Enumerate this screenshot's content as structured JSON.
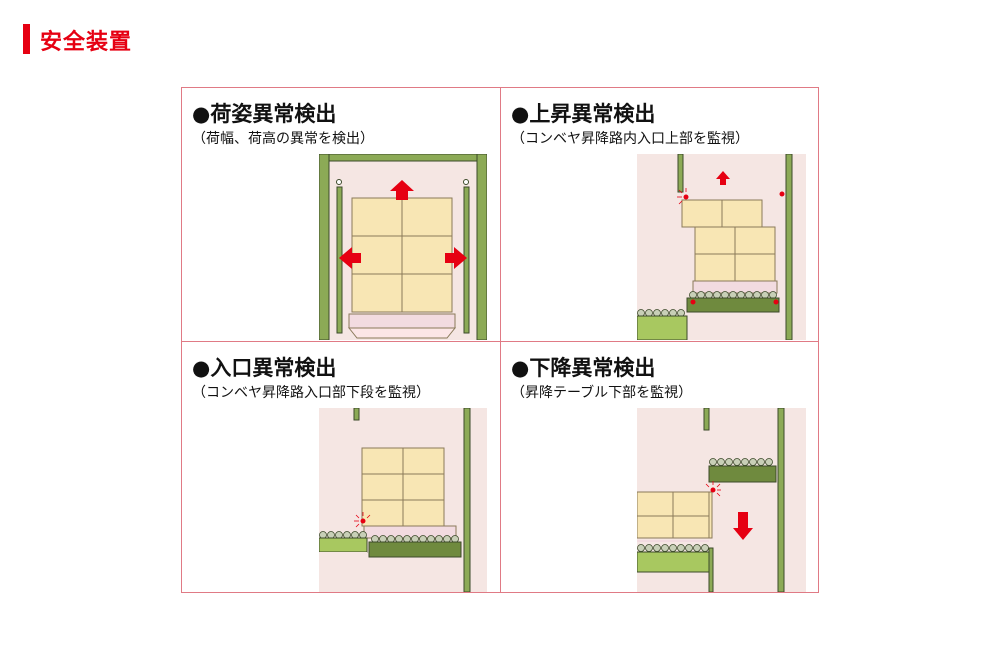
{
  "page": {
    "title": "安全装置"
  },
  "panels": [
    {
      "title": "●荷姿異常検出",
      "subtitle": "（荷幅、荷高の異常を検出）"
    },
    {
      "title": "●上昇異常検出",
      "subtitle": "（コンベヤ昇降路内入口上部を監視）"
    },
    {
      "title": "●入口異常検出",
      "subtitle": "（コンベヤ昇降路入口部下段を監視）"
    },
    {
      "title": "●下降異常検出",
      "subtitle": "（昇降テーブル下部を監視）"
    }
  ],
  "colors": {
    "accent": "#e60012",
    "frame": "#e07a85",
    "bg_illustration": "#f5e6e3",
    "green": "#8caa56",
    "box": "#f8e6b4"
  }
}
